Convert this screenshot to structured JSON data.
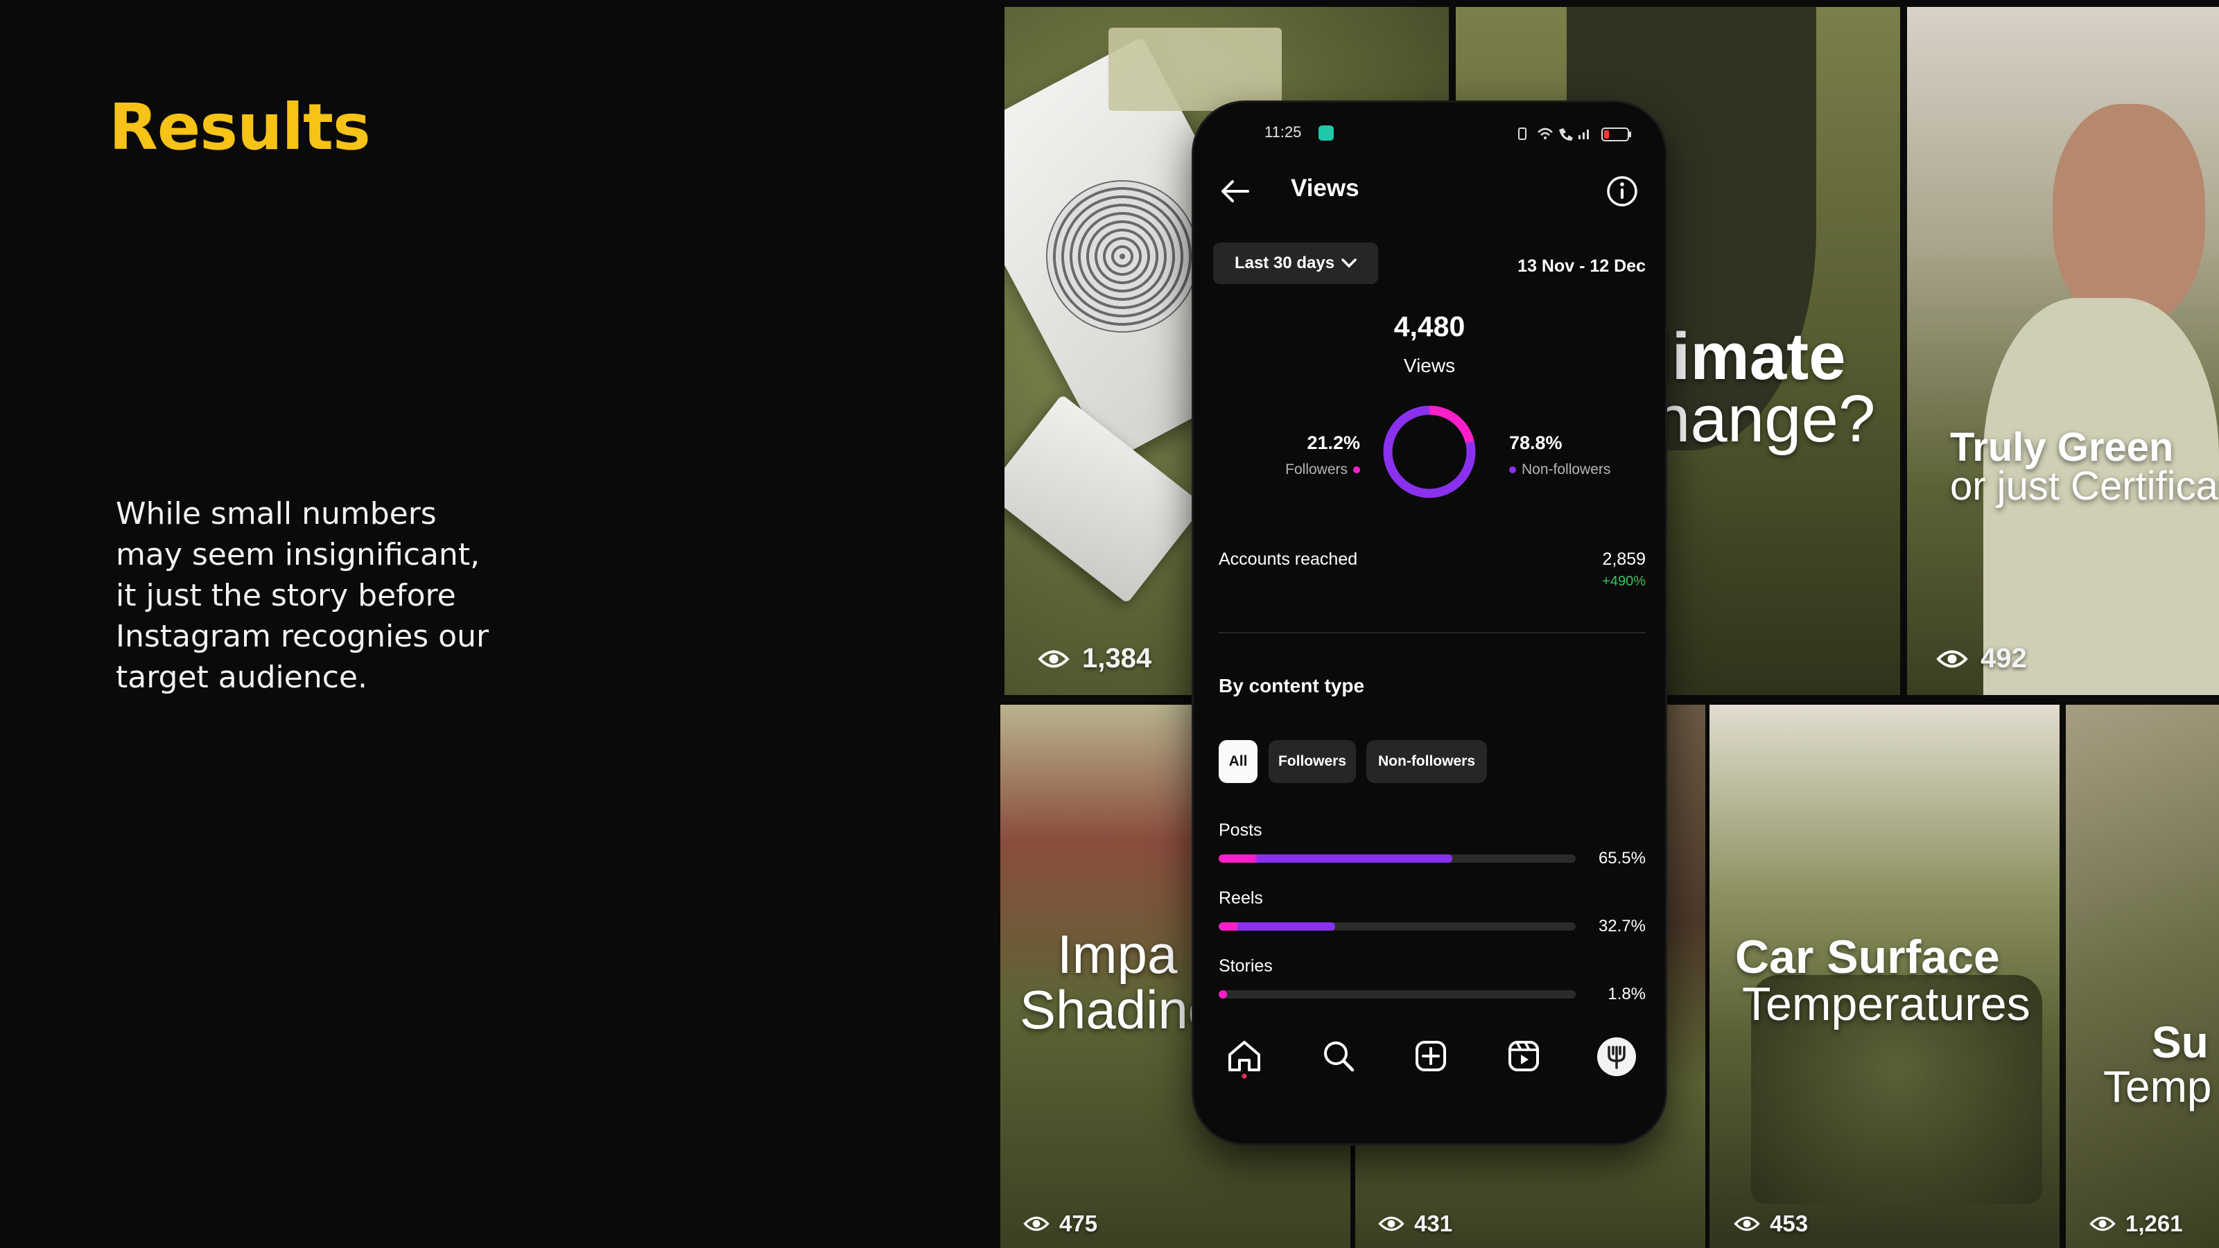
{
  "slide": {
    "title": "Results",
    "body_lines": [
      "While small numbers",
      "may seem insignificant,",
      "it just the story before",
      "Instagram recognies our",
      "target audience."
    ]
  },
  "tiles": [
    {
      "views": "1,384",
      "overlay": ""
    },
    {
      "views": "",
      "overlay_line1": "limate",
      "overlay_line2": "nange?"
    },
    {
      "views": "492",
      "overlay_line1": "Truly Green",
      "overlay_line2": "or just Certificati"
    },
    {
      "views": "475",
      "overlay_line1": "Impa",
      "overlay_line2": "Shading"
    },
    {
      "views": "431"
    },
    {
      "views": "453",
      "overlay_line1": "Car Surface",
      "overlay_line2": "Temperatures"
    },
    {
      "views": "1,261",
      "overlay_line1": "Su",
      "overlay_line2": "Temp"
    }
  ],
  "phone": {
    "status": {
      "time": "11:25"
    },
    "header": {
      "title": "Views"
    },
    "filter": {
      "range_label": "Last 30 days",
      "dates": "13 Nov - 12 Dec"
    },
    "total": {
      "value": "4,480",
      "label": "Views"
    },
    "split": {
      "followers_pct": "21.2%",
      "followers_label": "Followers",
      "non_followers_pct": "78.8%",
      "non_followers_label": "Non-followers",
      "followers_fraction": 0.212
    },
    "reach": {
      "label": "Accounts reached",
      "value": "2,859",
      "change": "+490%"
    },
    "content_type": {
      "title": "By content type",
      "tabs": [
        "All",
        "Followers",
        "Non-followers"
      ],
      "rows": [
        {
          "label": "Posts",
          "pct": "65.5%",
          "value": 0.655
        },
        {
          "label": "Reels",
          "pct": "32.7%",
          "value": 0.327
        },
        {
          "label": "Stories",
          "pct": "1.8%",
          "value": 0.018
        }
      ]
    },
    "nav": [
      "home-icon",
      "search-icon",
      "create-icon",
      "reels-icon",
      "profile-avatar"
    ]
  },
  "colors": {
    "accent_yellow": "#f6c316",
    "followers_pink": "#ff1fc8",
    "non_followers_purple": "#8a31ef",
    "positive_green": "#3bc45b",
    "tile_olive": "#5b6234"
  }
}
